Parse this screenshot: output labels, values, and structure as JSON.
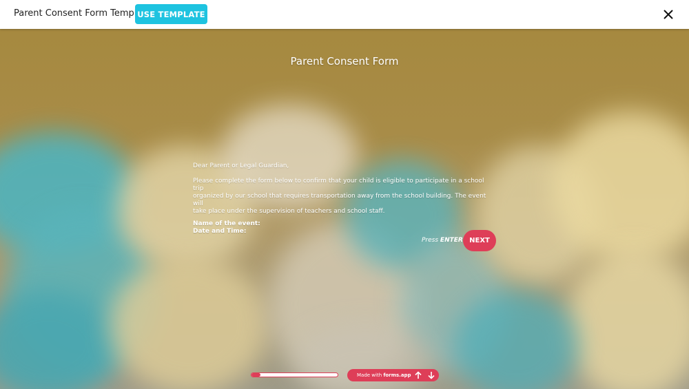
{
  "topbar": {
    "title": "Parent Consent Form Template",
    "use_template_label": "USE TEMPLATE",
    "close_icon": "close-icon"
  },
  "form": {
    "title": "Parent Consent Form",
    "greeting": "Dear Parent or Legal Guardian,",
    "body_line1": "Please complete the form below to confirm that your child is eligible to participate in a school trip",
    "body_line2": "organized by our school that requires transportation away from the school building. The event will",
    "body_line3": "take place under the supervision of teachers and school staff.",
    "event_name_label": "Name of the event:",
    "date_time_label": "Date and Time:",
    "press_label": "Press",
    "enter_label": "ENTER",
    "next_label": "NEXT"
  },
  "footer": {
    "progress_fraction": 0.1,
    "made_with_label": "Made with",
    "brand": "forms.app",
    "up_icon": "arrow-up-icon",
    "down_icon": "arrow-down-icon"
  },
  "colors": {
    "accent": "#de3e58",
    "use_template_bg": "#1ec3e0",
    "background": "#a88b45",
    "smoke_teal": "#4fb3bd",
    "smoke_cream": "#e6d6a6"
  }
}
